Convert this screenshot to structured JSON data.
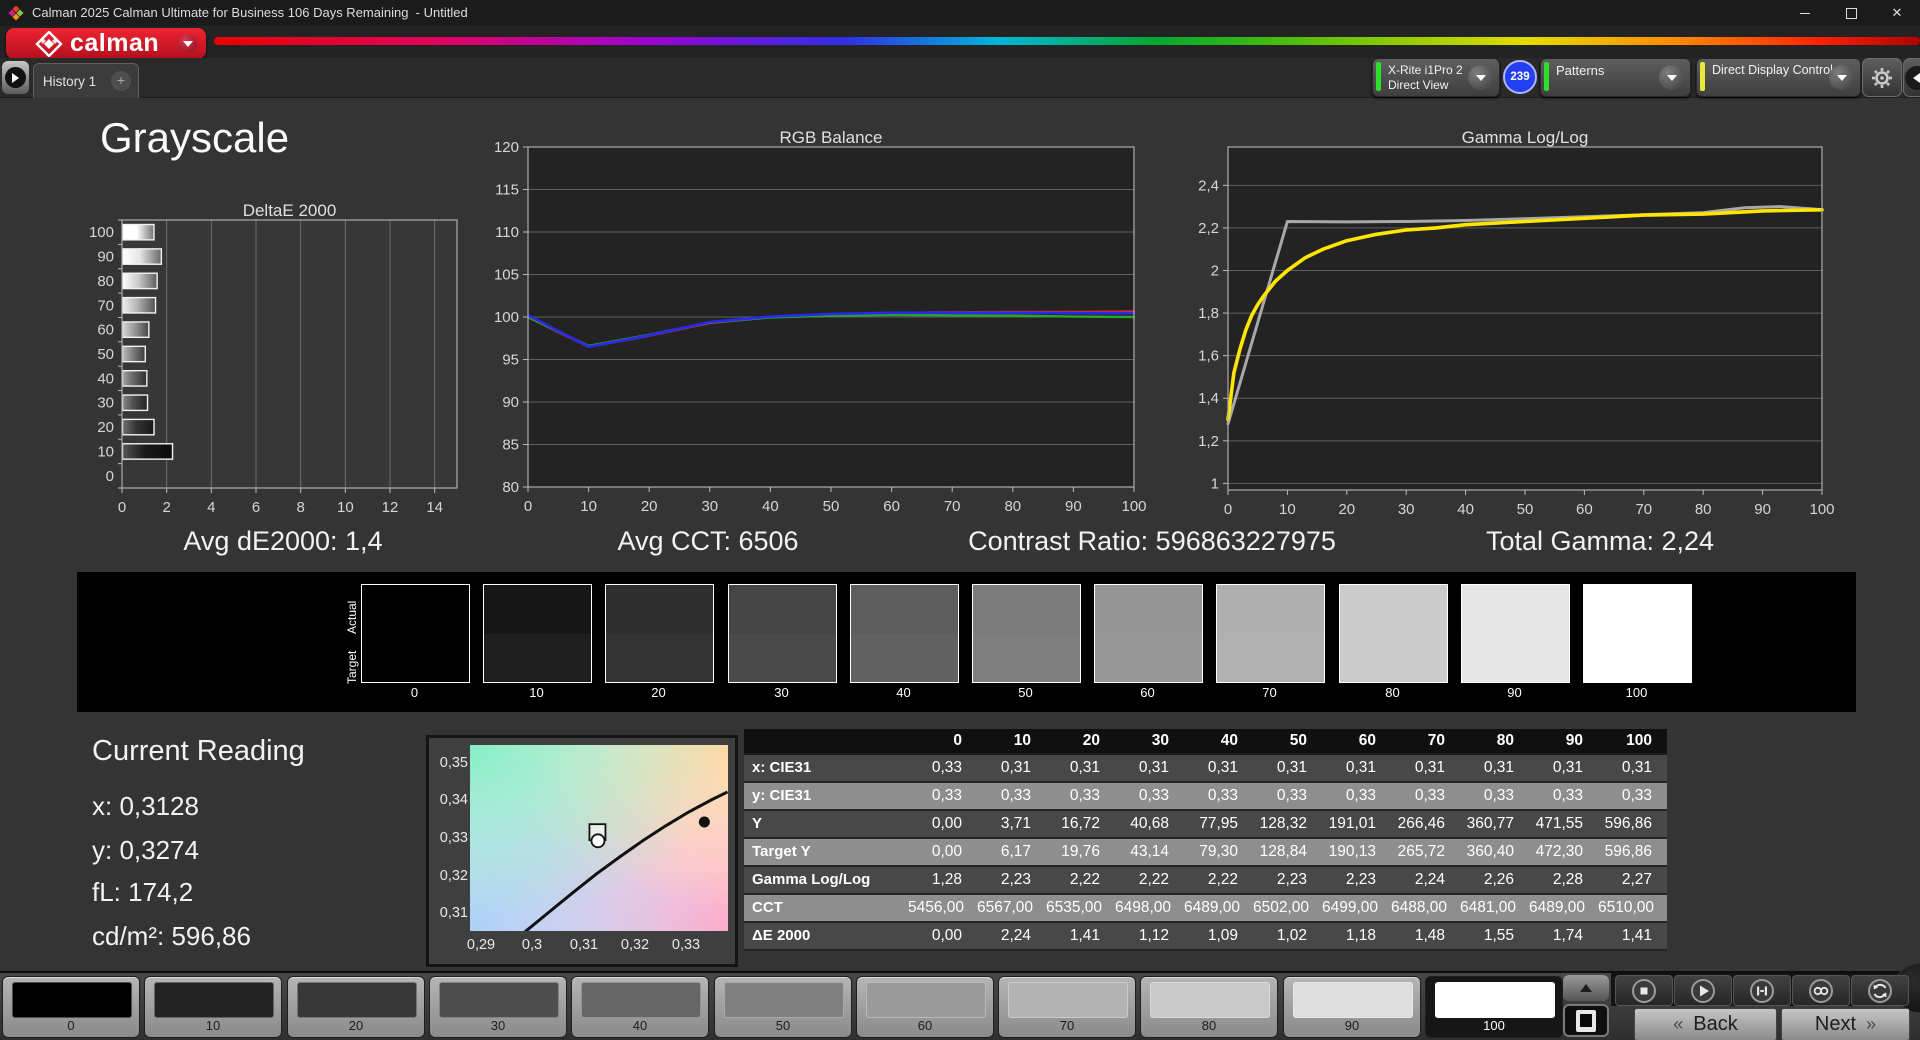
{
  "window": {
    "title": "Calman 2025 Calman Ultimate for Business 106 Days Remaining  - Untitled"
  },
  "brand": {
    "logo_text": "calman"
  },
  "toolbar": {
    "history_tab": "History 1",
    "add_tab": "+",
    "meter_device": "X-Rite i1Pro 2",
    "meter_mode": "Direct View",
    "meter_count": "239",
    "patterns_label": "Patterns",
    "display_control_label": "Direct Display Control",
    "meter_accent": "#2ee02e",
    "patterns_accent": "#2ee02e",
    "display_control_accent": "#e8e838"
  },
  "page_title": "Grayscale",
  "stats": {
    "avg_de2000": "Avg dE2000: 1,4",
    "avg_cct": "Avg CCT: 6506",
    "contrast_ratio": "Contrast Ratio: 596863227975",
    "total_gamma": "Total Gamma: 2,24"
  },
  "current_reading": {
    "title": "Current Reading",
    "x": "x: 0,3128",
    "y": "y: 0,3274",
    "fl": "fL: 174,2",
    "cdm2": "cd/m²: 596,86"
  },
  "strip": {
    "actual_label": "Actual",
    "target_label": "Target",
    "levels": [
      {
        "label": "0",
        "actual": "#000000",
        "target": "#000000"
      },
      {
        "label": "10",
        "actual": "#161616",
        "target": "#1f1f1f"
      },
      {
        "label": "20",
        "actual": "#2d2d2d",
        "target": "#333333"
      },
      {
        "label": "30",
        "actual": "#454545",
        "target": "#4a4a4a"
      },
      {
        "label": "40",
        "actual": "#5d5d5d",
        "target": "#616161"
      },
      {
        "label": "50",
        "actual": "#7b7b7b",
        "target": "#7e7e7e"
      },
      {
        "label": "60",
        "actual": "#959595",
        "target": "#979797"
      },
      {
        "label": "70",
        "actual": "#b0b0b0",
        "target": "#b1b1b1"
      },
      {
        "label": "80",
        "actual": "#cbcbcb",
        "target": "#cbcbcb"
      },
      {
        "label": "90",
        "actual": "#e6e6e6",
        "target": "#e5e5e5"
      },
      {
        "label": "100",
        "actual": "#ffffff",
        "target": "#ffffff"
      }
    ]
  },
  "table": {
    "columns": [
      "",
      "0",
      "10",
      "20",
      "30",
      "40",
      "50",
      "60",
      "70",
      "80",
      "90",
      "100"
    ],
    "rows": [
      {
        "label": "x: CIE31",
        "values": [
          "0,33",
          "0,31",
          "0,31",
          "0,31",
          "0,31",
          "0,31",
          "0,31",
          "0,31",
          "0,31",
          "0,31",
          "0,31"
        ]
      },
      {
        "label": "y: CIE31",
        "values": [
          "0,33",
          "0,33",
          "0,33",
          "0,33",
          "0,33",
          "0,33",
          "0,33",
          "0,33",
          "0,33",
          "0,33",
          "0,33"
        ]
      },
      {
        "label": "Y",
        "values": [
          "0,00",
          "3,71",
          "16,72",
          "40,68",
          "77,95",
          "128,32",
          "191,01",
          "266,46",
          "360,77",
          "471,55",
          "596,86"
        ]
      },
      {
        "label": "Target Y",
        "values": [
          "0,00",
          "6,17",
          "19,76",
          "43,14",
          "79,30",
          "128,84",
          "190,13",
          "265,72",
          "360,40",
          "472,30",
          "596,86"
        ]
      },
      {
        "label": "Gamma Log/Log",
        "values": [
          "1,28",
          "2,23",
          "2,22",
          "2,22",
          "2,22",
          "2,23",
          "2,23",
          "2,24",
          "2,26",
          "2,28",
          "2,27"
        ]
      },
      {
        "label": "CCT",
        "values": [
          "5456,00",
          "6567,00",
          "6535,00",
          "6498,00",
          "6489,00",
          "6502,00",
          "6499,00",
          "6488,00",
          "6481,00",
          "6489,00",
          "6510,00"
        ]
      },
      {
        "label": "ΔE 2000",
        "values": [
          "0,00",
          "2,24",
          "1,41",
          "1,12",
          "1,09",
          "1,02",
          "1,18",
          "1,48",
          "1,55",
          "1,74",
          "1,41"
        ]
      }
    ]
  },
  "chart_data": [
    {
      "type": "bar",
      "title": "DeltaE 2000",
      "orientation": "horizontal",
      "categories": [
        100,
        90,
        80,
        70,
        60,
        50,
        40,
        30,
        20,
        10,
        0
      ],
      "values": [
        1.41,
        1.74,
        1.55,
        1.48,
        1.18,
        1.02,
        1.09,
        1.12,
        1.41,
        2.24,
        0.0
      ],
      "xlim": [
        0,
        15
      ],
      "xticks": [
        0,
        2,
        4,
        6,
        8,
        10,
        12,
        14
      ],
      "grid": "vertical"
    },
    {
      "type": "line",
      "title": "RGB Balance",
      "x": [
        0,
        10,
        20,
        30,
        40,
        50,
        60,
        70,
        80,
        90,
        100
      ],
      "ylim": [
        80,
        120
      ],
      "yticks": [
        80,
        85,
        90,
        95,
        100,
        105,
        110,
        115,
        120
      ],
      "xticks": [
        0,
        10,
        20,
        30,
        40,
        50,
        60,
        70,
        80,
        90,
        100
      ],
      "grid": "horizontal",
      "series": [
        {
          "name": "Red",
          "color": "#d42a2a",
          "values": [
            100,
            96.5,
            97.8,
            99.3,
            100.0,
            100.3,
            100.5,
            100.55,
            100.6,
            100.6,
            100.65
          ]
        },
        {
          "name": "Green",
          "color": "#28a828",
          "values": [
            100,
            96.6,
            97.9,
            99.35,
            99.95,
            100.15,
            100.25,
            100.2,
            100.15,
            100.05,
            100.0
          ]
        },
        {
          "name": "Blue",
          "color": "#2828f0",
          "values": [
            100.2,
            96.5,
            97.85,
            99.4,
            100.05,
            100.35,
            100.5,
            100.5,
            100.5,
            100.45,
            100.45
          ]
        }
      ]
    },
    {
      "type": "line",
      "title": "Gamma Log/Log",
      "ylim": [
        0.969,
        2.58
      ],
      "yticks": [
        1,
        1.2,
        1.4,
        1.6,
        1.8,
        2,
        2.2,
        2.4
      ],
      "ytick_labels": [
        "1",
        "1,2",
        "1,4",
        "1,6",
        "1,8",
        "2",
        "2,2",
        "2,4"
      ],
      "xticks": [
        0,
        10,
        20,
        30,
        40,
        50,
        60,
        70,
        80,
        90,
        100
      ],
      "grid": "horizontal",
      "series": [
        {
          "name": "Target Gamma",
          "color": "#a8a8a8",
          "x": [
            0,
            10,
            20,
            30,
            40,
            50,
            60,
            70,
            80,
            87,
            93,
            100
          ],
          "values": [
            1.28,
            2.23,
            2.228,
            2.23,
            2.235,
            2.243,
            2.252,
            2.262,
            2.272,
            2.295,
            2.3,
            2.286
          ]
        },
        {
          "name": "Measured Gamma",
          "color": "#ffe600",
          "x": [
            0,
            1,
            2,
            3,
            4,
            5,
            6,
            8,
            10,
            13,
            16,
            20,
            25,
            30,
            35,
            40,
            50,
            60,
            70,
            80,
            90,
            100
          ],
          "values": [
            1.3,
            1.52,
            1.63,
            1.72,
            1.79,
            1.84,
            1.88,
            1.95,
            2.0,
            2.06,
            2.1,
            2.14,
            2.17,
            2.19,
            2.2,
            2.215,
            2.23,
            2.245,
            2.26,
            2.265,
            2.28,
            2.285
          ]
        }
      ]
    },
    {
      "type": "scatter",
      "title": "CIE xy detail",
      "xlim": [
        0.2879,
        0.3381
      ],
      "ylim": [
        0.3055,
        0.355
      ],
      "xticks": [
        0.29,
        0.3,
        0.31,
        0.32,
        0.33
      ],
      "xtick_labels": [
        "0,29",
        "0,3",
        "0,31",
        "0,32",
        "0,33"
      ],
      "yticks": [
        0.35,
        0.34,
        0.33,
        0.32,
        0.31
      ],
      "ytick_labels": [
        "0,35",
        "0,34",
        "0,33",
        "0,32",
        "0,31"
      ],
      "locus": [
        [
          0.2945,
          0.3005
        ],
        [
          0.299,
          0.3057
        ],
        [
          0.3035,
          0.3108
        ],
        [
          0.308,
          0.3158
        ],
        [
          0.3125,
          0.3207
        ],
        [
          0.317,
          0.3252
        ],
        [
          0.3215,
          0.3295
        ],
        [
          0.326,
          0.3335
        ],
        [
          0.3305,
          0.3372
        ],
        [
          0.335,
          0.3405
        ],
        [
          0.338,
          0.3425
        ]
      ],
      "markers": [
        {
          "shape": "square",
          "x": 0.3127,
          "y": 0.3318,
          "name": "target-point"
        },
        {
          "shape": "circle",
          "x": 0.3128,
          "y": 0.3295,
          "name": "current-reading-point"
        },
        {
          "shape": "dot",
          "x": 0.3335,
          "y": 0.3345,
          "name": "reference-point"
        }
      ]
    }
  ],
  "bottom_bar": {
    "patches": [
      {
        "label": "0",
        "color": "#000000",
        "selected": false
      },
      {
        "label": "10",
        "color": "#232323",
        "selected": false
      },
      {
        "label": "20",
        "color": "#383838",
        "selected": false
      },
      {
        "label": "30",
        "color": "#4e4e4e",
        "selected": false
      },
      {
        "label": "40",
        "color": "#666666",
        "selected": false
      },
      {
        "label": "50",
        "color": "#808080",
        "selected": false
      },
      {
        "label": "60",
        "color": "#9b9b9b",
        "selected": false
      },
      {
        "label": "70",
        "color": "#b3b3b3",
        "selected": false
      },
      {
        "label": "80",
        "color": "#c9c9c9",
        "selected": false
      },
      {
        "label": "90",
        "color": "#dedede",
        "selected": false
      },
      {
        "label": "100",
        "color": "#ffffff",
        "selected": true
      }
    ],
    "transport": [
      {
        "name": "stop"
      },
      {
        "name": "play"
      },
      {
        "name": "interval"
      },
      {
        "name": "continuous"
      },
      {
        "name": "refresh"
      }
    ],
    "back_label": "Back",
    "next_label": "Next",
    "back_chevron": "«",
    "next_chevron": "»"
  }
}
